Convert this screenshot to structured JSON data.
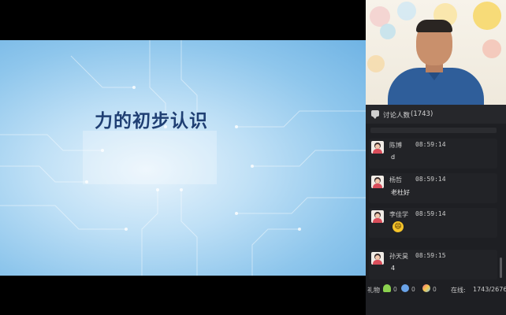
{
  "slide": {
    "title": "力的初步认识"
  },
  "discussion": {
    "label": "讨论人数",
    "count": "(1743)"
  },
  "messages": [
    {
      "name": "陈博",
      "time": "08:59:14",
      "text": "d"
    },
    {
      "name": "杨哲",
      "time": "08:59:14",
      "text": "老杜好"
    },
    {
      "name": "李佳学",
      "time": "08:59:14",
      "emoji": "😄"
    },
    {
      "name": "孙天昊",
      "time": "08:59:15",
      "text": "4"
    }
  ],
  "bottom": {
    "gift_label": "礼物",
    "gifts": [
      {
        "icon": "flower-icon",
        "count": "0"
      },
      {
        "icon": "planet-icon",
        "count": "0"
      },
      {
        "icon": "balloon-icon",
        "count": "0"
      }
    ],
    "online_label": "在线:",
    "online_count": "1743/2676"
  },
  "colors": {
    "slide_title": "#1f3f73",
    "panel_bg": "#1e1f23",
    "uniform": "#2f5e9a"
  }
}
